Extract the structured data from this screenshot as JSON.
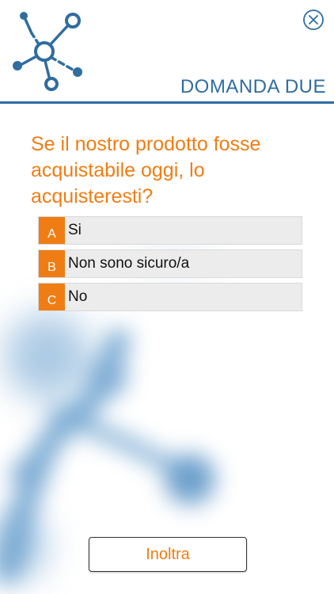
{
  "header": {
    "title": "DOMANDA DUE"
  },
  "icons": {
    "logo": "network-nodes-icon",
    "close": "close-circle-icon"
  },
  "question": {
    "text": "Se il nostro prodotto fosse acquistabile oggi, lo acquisteresti?"
  },
  "answers": [
    {
      "letter": "A",
      "label": "Si"
    },
    {
      "letter": "B",
      "label": "Non sono sicuro/a"
    },
    {
      "letter": "C",
      "label": "No"
    }
  ],
  "submit": {
    "label": "Inoltra"
  },
  "colors": {
    "accent": "#ef7d14",
    "brand": "#2f6d9f",
    "answer_bg": "#ececec"
  }
}
